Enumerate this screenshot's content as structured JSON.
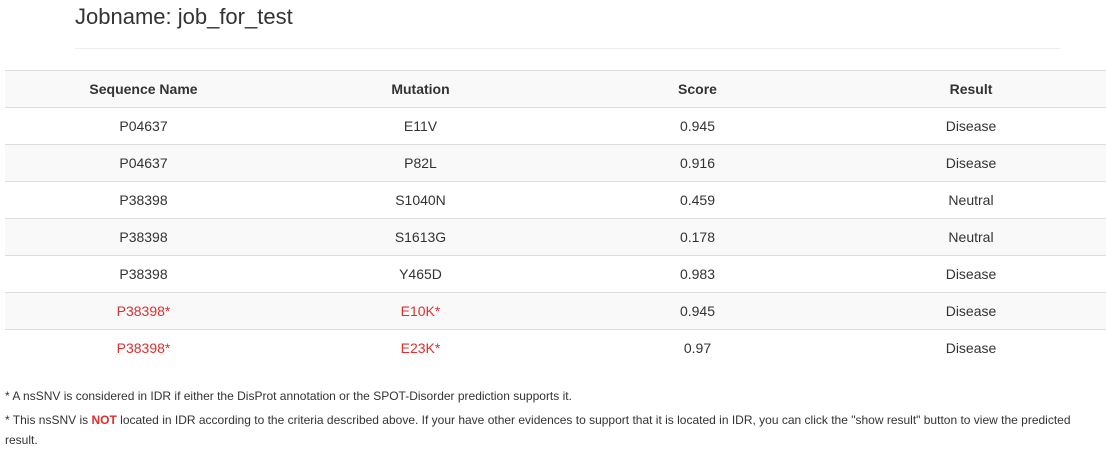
{
  "header": {
    "title": "Jobname: job_for_test"
  },
  "table": {
    "columns": [
      "Sequence Name",
      "Mutation",
      "Score",
      "Result"
    ],
    "rows": [
      {
        "seq": "P04637",
        "mutation": "E11V",
        "score": "0.945",
        "result": "Disease",
        "highlight": false
      },
      {
        "seq": "P04637",
        "mutation": "P82L",
        "score": "0.916",
        "result": "Disease",
        "highlight": false
      },
      {
        "seq": "P38398",
        "mutation": "S1040N",
        "score": "0.459",
        "result": "Neutral",
        "highlight": false
      },
      {
        "seq": "P38398",
        "mutation": "S1613G",
        "score": "0.178",
        "result": "Neutral",
        "highlight": false
      },
      {
        "seq": "P38398",
        "mutation": "Y465D",
        "score": "0.983",
        "result": "Disease",
        "highlight": false
      },
      {
        "seq": "P38398*",
        "mutation": "E10K*",
        "score": "0.945",
        "result": "Disease",
        "highlight": true
      },
      {
        "seq": "P38398*",
        "mutation": "E23K*",
        "score": "0.97",
        "result": "Disease",
        "highlight": true
      }
    ]
  },
  "notes": {
    "note1": "* A nsSNV is considered in IDR if either the DisProt annotation or the SPOT-Disorder prediction supports it.",
    "note2_prefix": "* This nsSNV is ",
    "note2_emphasis": "NOT",
    "note2_suffix": " located in IDR according to the criteria described above. If your have other evidences to support that it is located in IDR, you can click the \"show result\" button to view the predicted result."
  },
  "colors": {
    "highlight": "#e32d2d",
    "stripe": "#f9f9f9",
    "border": "#dddddd"
  }
}
